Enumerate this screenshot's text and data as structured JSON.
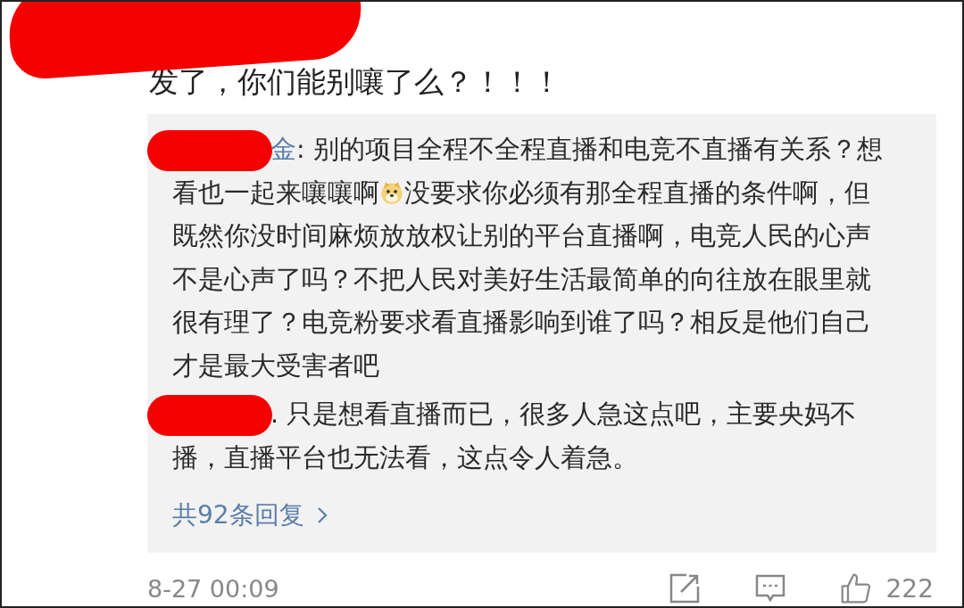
{
  "comment": {
    "text": "发了，你们能别嚷了么？！！！"
  },
  "replies": [
    {
      "author": "金",
      "separator": ":",
      "segments": [
        {
          "kind": "text",
          "text": " 别的项目全程不全程直播和电竞不直播有关系？想看也一起来嚷嚷啊"
        },
        {
          "kind": "emoji"
        },
        {
          "kind": "text",
          "text": "没要求你必须有那全程直播的条件啊，但既然你没时间麻烦放放权让别的平台直播啊，电竞人民的心声不是心声了吗？不把人民对美好生活最简单的向往放在眼里就很有理了？电竞粉要求看直播影响到谁了吗？相反是他们自己才是最大受害者吧"
        }
      ]
    },
    {
      "separator": ".",
      "segments": [
        {
          "kind": "text",
          "text": " 只是想看直播而已，很多人急这点吧，主要央妈不播，直播平台也无法看，这点令人着急。"
        }
      ]
    }
  ],
  "more_replies": "共92条回复",
  "footer": {
    "time": "8-27 00:09",
    "likes": "222"
  }
}
